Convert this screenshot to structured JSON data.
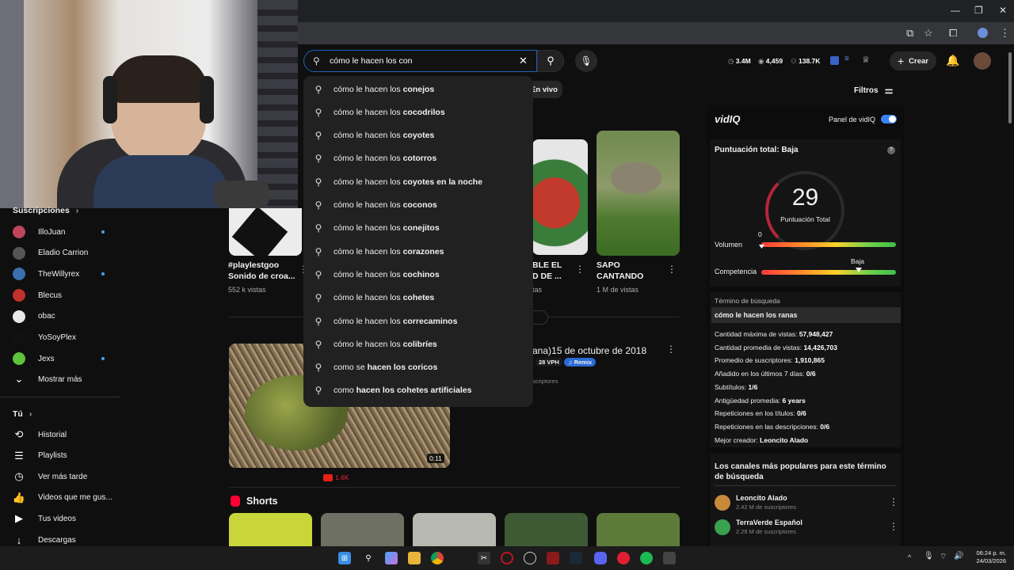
{
  "search": {
    "value": "cómo le hacen los con",
    "suggestions": [
      {
        "prefix": "cómo le hacen los ",
        "bold": "conejos"
      },
      {
        "prefix": "cómo le hacen los ",
        "bold": "cocodrilos"
      },
      {
        "prefix": "cómo le hacen los ",
        "bold": "coyotes"
      },
      {
        "prefix": "cómo le hacen los ",
        "bold": "cotorros"
      },
      {
        "prefix": "cómo le hacen los ",
        "bold": "coyotes en la noche"
      },
      {
        "prefix": "cómo le hacen los ",
        "bold": "coconos"
      },
      {
        "prefix": "cómo le hacen los ",
        "bold": "conejitos"
      },
      {
        "prefix": "cómo le hacen los ",
        "bold": "corazones"
      },
      {
        "prefix": "cómo le hacen los ",
        "bold": "cochinos"
      },
      {
        "prefix": "cómo le hacen los ",
        "bold": "cohetes"
      },
      {
        "prefix": "cómo le hacen los ",
        "bold": "correcaminos"
      },
      {
        "prefix": "cómo le hacen los ",
        "bold": "colibríes"
      },
      {
        "prefix": "como se ",
        "bold": "hacen los coricos"
      },
      {
        "prefix": "como ",
        "bold": "hacen los cohetes artificiales"
      }
    ]
  },
  "header": {
    "stats": [
      "3.4M",
      "4,459",
      "138.7K"
    ],
    "create_label": "Crear",
    "chip_en_vivo": "En vivo",
    "filtros": "Filtros"
  },
  "sidebar": {
    "subs_title": "Suscripciones",
    "subs": [
      {
        "name": "IlloJuan",
        "dot": true,
        "color": "#c0455a"
      },
      {
        "name": "Eladio Carrion",
        "dot": false,
        "color": "#555"
      },
      {
        "name": "TheWillyrex",
        "dot": true,
        "color": "#3a6fb0"
      },
      {
        "name": "Blecus",
        "dot": false,
        "color": "#c2312b"
      },
      {
        "name": "obac",
        "dot": false,
        "color": "#e8e8e8"
      },
      {
        "name": "YoSoyPlex",
        "dot": false,
        "color": "#111"
      },
      {
        "name": "Jexs",
        "dot": true,
        "color": "#5ec23a"
      }
    ],
    "show_more": "Mostrar más",
    "you_title": "Tú",
    "you_items": [
      {
        "label": "Historial",
        "icon": "history-icon",
        "glyph": "⟲"
      },
      {
        "label": "Playlists",
        "icon": "playlists-icon",
        "glyph": "☰"
      },
      {
        "label": "Ver más tarde",
        "icon": "clock-icon",
        "glyph": "◷"
      },
      {
        "label": "Videos que me gus...",
        "icon": "thumbs-up-icon",
        "glyph": "👍"
      },
      {
        "label": "Tus videos",
        "icon": "your-videos-icon",
        "glyph": "▶"
      },
      {
        "label": "Descargas",
        "icon": "download-icon",
        "glyph": "↓"
      }
    ]
  },
  "videos": {
    "v1": {
      "title1": "#playlestgoo",
      "title2": "Sonido de croa...",
      "meta": "552 k vistas"
    },
    "v3": {
      "title1": "BLE EL",
      "title2": "D DE ...",
      "meta": "tas"
    },
    "v4": {
      "title1": "SAPO",
      "title2": "CANTANDO",
      "meta": "1 M de vistas"
    },
    "long": {
      "title": "ana)15 de octubre de 2018",
      "vph": "28 VPH",
      "remix": "Remix",
      "sub": "scriptores",
      "duration": "0:11",
      "views": "1.6K"
    },
    "shorts_title": "Shorts"
  },
  "vidiq": {
    "logo": "vidIQ",
    "panel_label": "Panel de vidIQ",
    "score_title": "Puntuación total: Baja",
    "score": "29",
    "score_label": "Puntuación Total",
    "volume_label": "Volumen",
    "volume_value": "0",
    "competition_label": "Competencia",
    "competition_value": "Baja",
    "term_label": "Término de búsqueda",
    "term": "cómo le hacen los ranas",
    "rows": [
      {
        "k": "Cantidad máxima de vistas: ",
        "v": "57,948,427"
      },
      {
        "k": "Cantidad promedia de vistas: ",
        "v": "14,426,703"
      },
      {
        "k": "Promedio de suscriptores: ",
        "v": "1,910,865"
      },
      {
        "k": "Añadido en los últimos 7 días: ",
        "v": "0/6"
      },
      {
        "k": "Subtítulos: ",
        "v": "1/6"
      },
      {
        "k": "Antigüedad promedia: ",
        "v": "6 years"
      },
      {
        "k": "Repeticiones en los títulos: ",
        "v": "0/6"
      },
      {
        "k": "Repeticiones en las descripciones: ",
        "v": "0/6"
      },
      {
        "k": "Mejor creador: ",
        "v": "Leoncito Alado"
      }
    ],
    "channels_title": "Los canales más populares para este término de búsqueda",
    "channels": [
      {
        "name": "Leoncito Alado",
        "subs": "2.42 M de suscriptores"
      },
      {
        "name": "TerraVerde Español",
        "subs": "2.28 M de suscriptores"
      }
    ]
  },
  "taskbar": {
    "time": "06:24 p. m.",
    "date": "24/03/2026"
  },
  "colors": {
    "accent": "#3ea6ff",
    "youtube_red": "#ff0000",
    "vidiq_toggle": "#3b82f6"
  }
}
